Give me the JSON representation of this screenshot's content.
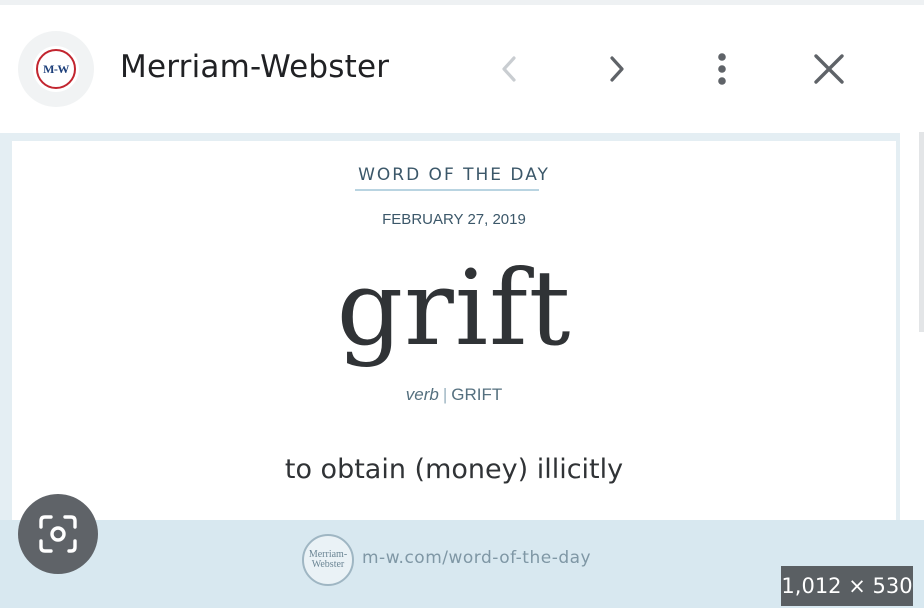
{
  "header": {
    "logo_text": "M-W",
    "site_title": "Merriam-Webster",
    "icons": [
      "back-arrow-icon",
      "forward-arrow-icon",
      "more-vert-icon",
      "close-icon"
    ]
  },
  "card": {
    "label": "WORD OF THE DAY",
    "date": "FEBRUARY 27, 2019",
    "word": "grift",
    "part_of_speech": "verb",
    "separator": "|",
    "pronunciation": "GRIFT",
    "definition": "to obtain (money) illicitly"
  },
  "footer": {
    "seal_line1": "Merriam-",
    "seal_line2": "Webster",
    "url": "m-w.com/word-of-the-day"
  },
  "image_size": "1,012 × 530",
  "colors": {
    "accent_text": "#3b5769",
    "footer_band": "#d8e8f0",
    "logo_red": "#c2252f",
    "logo_blue": "#1d3f7a"
  }
}
